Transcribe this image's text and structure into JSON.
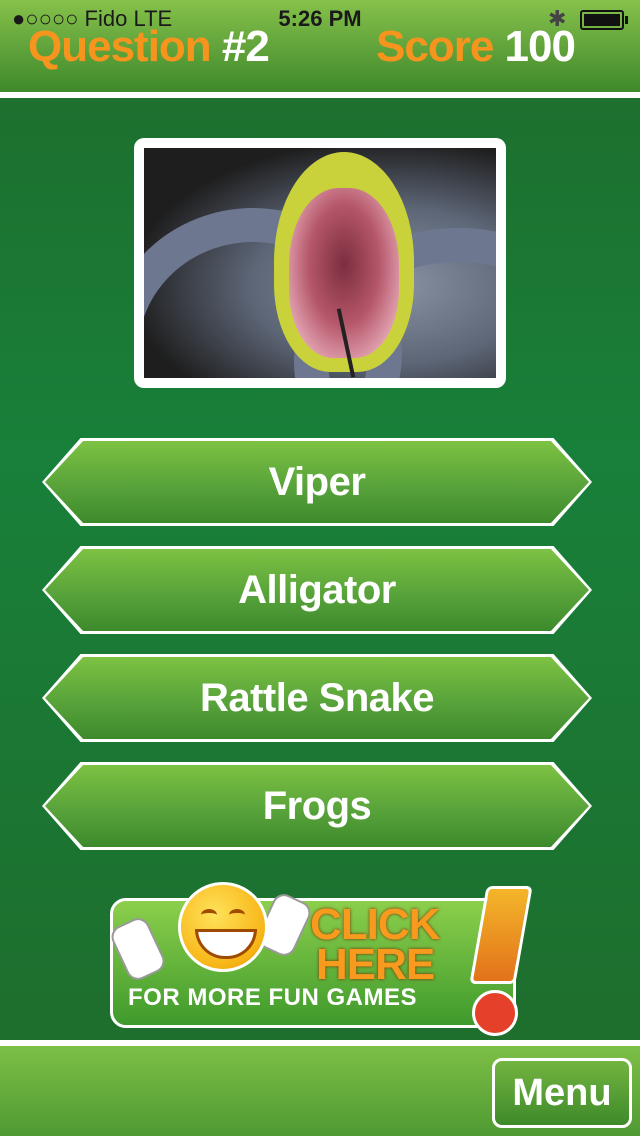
{
  "status_bar": {
    "carrier": "●○○○○ Fido  LTE",
    "time": "5:26 PM",
    "bluetooth_icon": "bluetooth-icon",
    "battery_icon": "battery-icon"
  },
  "hud": {
    "question_label": "Question",
    "question_number": "#2",
    "score_label": "Score",
    "score_value": "100"
  },
  "question_image": {
    "icon": "snake-photo"
  },
  "answers": [
    {
      "label": "Viper"
    },
    {
      "label": "Alligator"
    },
    {
      "label": "Rattle Snake"
    },
    {
      "label": "Frogs"
    }
  ],
  "promo": {
    "line1": "CLICK",
    "line2": "HERE",
    "subtitle": "FOR MORE FUN GAMES"
  },
  "footer": {
    "menu_label": "Menu"
  },
  "colors": {
    "accent_orange": "#f7941e",
    "button_green": "#58a33a",
    "background_green": "#18803a"
  }
}
